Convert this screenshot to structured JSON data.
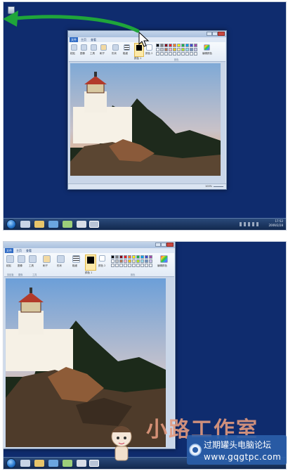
{
  "top_screen": {
    "taskbar": {
      "clock_time": "17:52",
      "clock_date": "2009/2/28"
    },
    "paint_window": {
      "tabs": [
        "文件",
        "主页",
        "查看"
      ],
      "labels": {
        "paste": "粘贴",
        "image": "图像",
        "tools": "工具",
        "brushes": "刷子",
        "shapes": "形状",
        "size": "粗细",
        "color1": "颜色 1",
        "color2": "颜色 2",
        "edit_colors": "编辑颜色",
        "colors_group": "颜色"
      },
      "zoom": "100%"
    }
  },
  "bottom_screen": {
    "paint_window": {
      "tabs": [
        "文件",
        "主页",
        "查看"
      ],
      "labels": {
        "paste": "粘贴",
        "image": "图像",
        "tools": "工具",
        "brushes": "刷子",
        "shapes": "形状",
        "size": "粗细",
        "color1": "颜色 1",
        "color2": "颜色 2",
        "edit_colors": "编辑颜色",
        "clipboard_group": "剪贴板",
        "image_group": "图像",
        "tools_group": "工具",
        "colors_group": "颜色"
      }
    }
  },
  "palette_colors": [
    "#000000",
    "#7f7f7f",
    "#880015",
    "#ed1c24",
    "#ff7f27",
    "#fff200",
    "#22b14c",
    "#00a2e8",
    "#3f48cc",
    "#a349a4",
    "#ffffff",
    "#c3c3c3",
    "#b97a57",
    "#ffaec9",
    "#ffc90e",
    "#efe4b0",
    "#b5e61d",
    "#99d9ea",
    "#7092be",
    "#c8bfe7",
    "#f0f0f0",
    "#f0f0f0",
    "#f0f0f0",
    "#f0f0f0",
    "#f0f0f0",
    "#f0f0f0",
    "#f0f0f0",
    "#f0f0f0",
    "#f0f0f0",
    "#f0f0f0"
  ],
  "watermark": {
    "title": "小路工作室",
    "site_name": "过期罐头电脑论坛",
    "site_url": "www.gqgtpc.com"
  },
  "colors": {
    "desktop": "#0f2c6e",
    "arrow": "#1fa53a",
    "accent_text": "#e39a7e"
  }
}
